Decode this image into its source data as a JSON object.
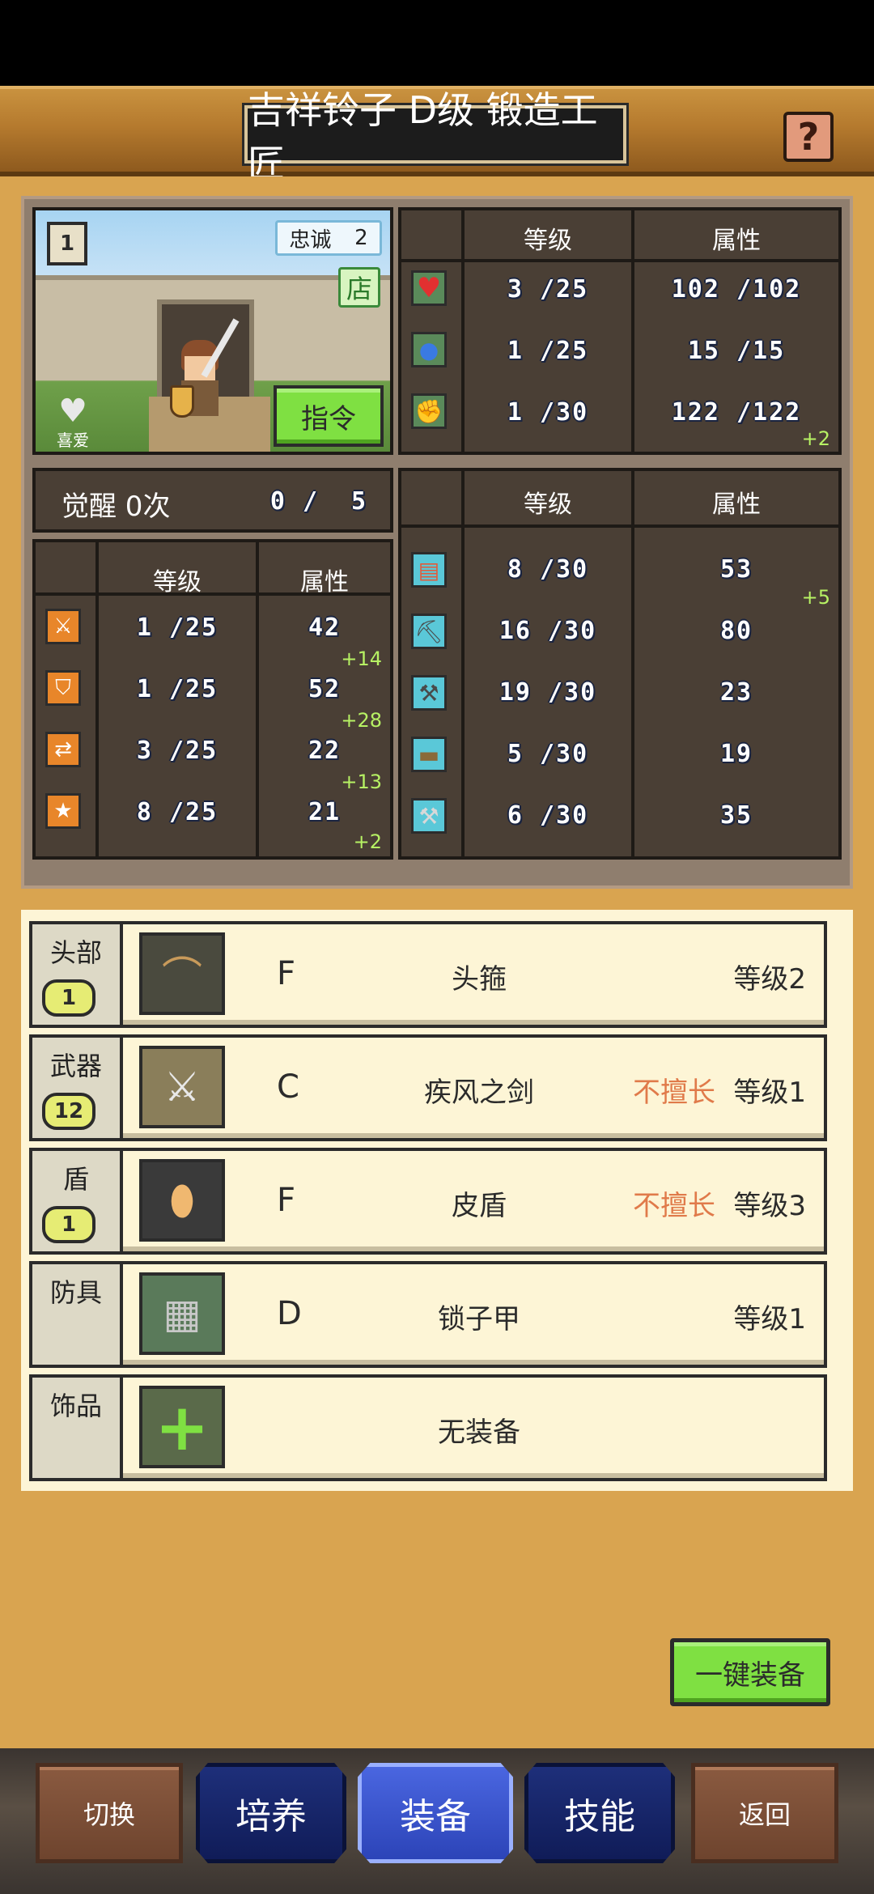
{
  "header": {
    "title": "吉祥铃子 D级 锻造工匠",
    "help_label": "?"
  },
  "character": {
    "loyalty_label": "忠诚",
    "loyalty_value": "2",
    "shop_label": "店",
    "like_label": "喜爱",
    "command_button": "指令",
    "card_number": "1"
  },
  "vitals": {
    "headers": {
      "level": "等级",
      "attr": "属性"
    },
    "rows": [
      {
        "icon": "heart-icon",
        "level": "3 /25",
        "attr": "102 /102",
        "bonus": ""
      },
      {
        "icon": "potion-icon",
        "level": "1 /25",
        "attr": "15 /15",
        "bonus": ""
      },
      {
        "icon": "muscle-icon",
        "level": "1 /30",
        "attr": "122 /122",
        "bonus": "+2"
      }
    ]
  },
  "awaken": {
    "label": "觉醒 0次",
    "progress": "0 /",
    "max": "5"
  },
  "combat": {
    "headers": {
      "level": "等级",
      "attr": "属性"
    },
    "rows": [
      {
        "icon": "sword-icon",
        "level": "1 /25",
        "attr": "42",
        "bonus": "+14"
      },
      {
        "icon": "shield-icon",
        "level": "1 /25",
        "attr": "52",
        "bonus": "+28"
      },
      {
        "icon": "agility-icon",
        "level": "3 /25",
        "attr": "22",
        "bonus": "+13"
      },
      {
        "icon": "star-icon",
        "level": "8 /25",
        "attr": "21",
        "bonus": "+2"
      }
    ]
  },
  "crafting": {
    "headers": {
      "level": "等级",
      "attr": "属性"
    },
    "rows": [
      {
        "icon": "book-icon",
        "level": "8 /30",
        "attr": "53",
        "bonus": "+5"
      },
      {
        "icon": "pickaxe-icon",
        "level": "16 /30",
        "attr": "80",
        "bonus": ""
      },
      {
        "icon": "shovel-icon",
        "level": "19 /30",
        "attr": "23",
        "bonus": ""
      },
      {
        "icon": "anvil-icon",
        "level": "5 /30",
        "attr": "19",
        "bonus": ""
      },
      {
        "icon": "hammer-icon",
        "level": "6 /30",
        "attr": "35",
        "bonus": ""
      }
    ]
  },
  "equipment": [
    {
      "slot": "头部",
      "badge": "1",
      "grade": "F",
      "name": "头箍",
      "weak": "",
      "level": "等级2",
      "icon": "headband-icon"
    },
    {
      "slot": "武器",
      "badge": "12",
      "grade": "C",
      "name": "疾风之剑",
      "weak": "不擅长",
      "level": "等级1",
      "icon": "sword-item-icon"
    },
    {
      "slot": "盾",
      "badge": "1",
      "grade": "F",
      "name": "皮盾",
      "weak": "不擅长",
      "level": "等级3",
      "icon": "leather-shield-icon"
    },
    {
      "slot": "防具",
      "badge": "",
      "grade": "D",
      "name": "锁子甲",
      "weak": "",
      "level": "等级1",
      "icon": "chainmail-icon"
    },
    {
      "slot": "饰品",
      "badge": "",
      "grade": "",
      "name": "无装备",
      "weak": "",
      "level": "",
      "icon": "plus-icon"
    }
  ],
  "one_key_button": "一键装备",
  "nav": {
    "switch": "切换",
    "train": "培养",
    "equip": "装备",
    "skill": "技能",
    "back": "返回"
  }
}
